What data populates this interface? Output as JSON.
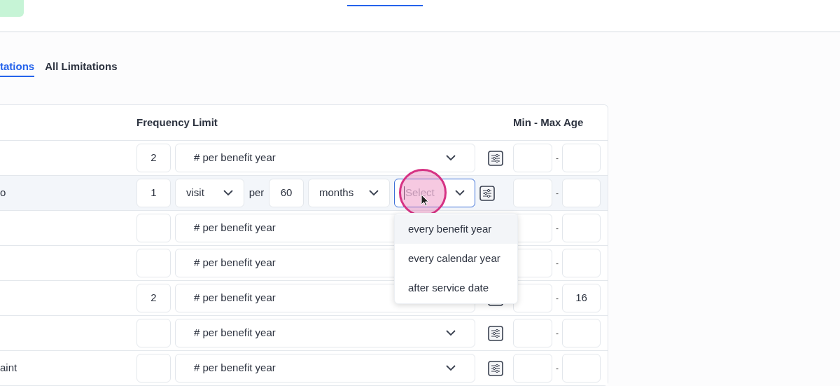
{
  "tabs": [
    {
      "label": "tations",
      "selected": true
    },
    {
      "label": "All Limitations",
      "selected": false
    }
  ],
  "table": {
    "columns": [
      "Frequency Limit",
      "Min - Max Age"
    ],
    "rows": [
      {
        "kind": "simple",
        "selected": false,
        "count": "2",
        "period": "# per benefit year",
        "age_separator": "-"
      },
      {
        "kind": "compound",
        "selected": true,
        "label": "o",
        "count": "1",
        "unit": "visit",
        "per": "per",
        "interval": "60",
        "interval_unit": "months",
        "qualifier": {
          "placeholder": "Select",
          "focused": true,
          "dropdown": [
            {
              "label": "every benefit year",
              "selected": true
            },
            {
              "label": "every calendar year",
              "selected": false
            },
            {
              "label": "after service date",
              "selected": false
            }
          ]
        },
        "age_separator": "-"
      },
      {
        "kind": "simple",
        "selected": false,
        "period": "# per benefit year",
        "age_separator": "-"
      },
      {
        "kind": "simple",
        "selected": false,
        "period": "# per benefit year",
        "age_separator": "-"
      },
      {
        "kind": "simple",
        "selected": false,
        "count": "2",
        "period": "# per benefit year",
        "age_separator": "-",
        "max_age": "16"
      },
      {
        "kind": "simple",
        "selected": false,
        "period": "# per benefit year",
        "age_separator": "-"
      },
      {
        "kind": "simple",
        "selected": false,
        "label": "aint",
        "period": "# per benefit year",
        "age_separator": "-"
      }
    ]
  }
}
